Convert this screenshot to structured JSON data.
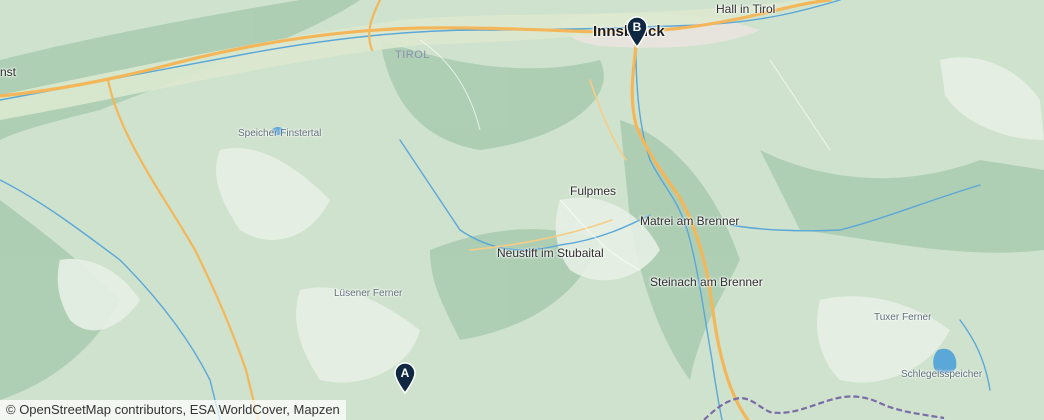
{
  "map": {
    "labels": {
      "innsbruck": "Innsbruck",
      "hall_in_tirol": "Hall in Tirol",
      "tirol": "TIROL",
      "speicher_finstertal": "Speicher Finstertal",
      "fulpmes": "Fulpmes",
      "matrei": "Matrei am Brenner",
      "neustift": "Neustift im Stubaital",
      "steinach": "Steinach am Brenner",
      "luesener_ferner": "Lüsener Ferner",
      "tuxer_ferner": "Tuxer Ferner",
      "schlegeisspeicher": "Schlegeisspeicher",
      "left_edge_fragment": "nst"
    },
    "markers": {
      "start": {
        "letter": "A"
      },
      "end": {
        "letter": "B"
      }
    },
    "attribution": "© OpenStreetMap contributors, ESA WorldCover, Mapzen",
    "colors": {
      "terrain": "#cfe2cd",
      "road": "#f3b75a",
      "water": "#5aa7d8",
      "border": "#7b6ba6",
      "marker": "#0f2741"
    }
  }
}
